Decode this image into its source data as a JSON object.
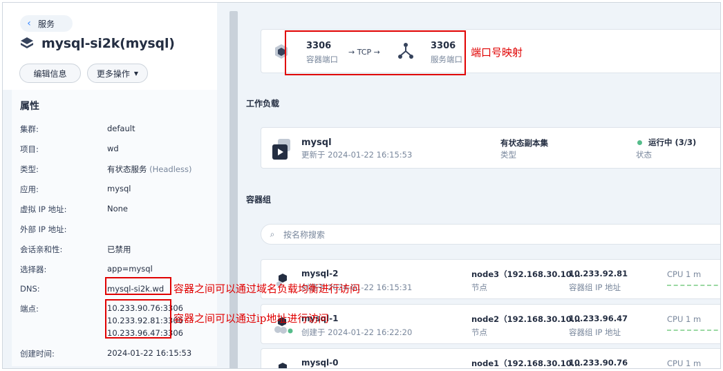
{
  "back_label": "服务",
  "service": {
    "name": "mysql-si2k(mysql)"
  },
  "buttons": {
    "edit": "编辑信息",
    "more": "更多操作"
  },
  "properties": {
    "title": "属性",
    "rows": {
      "cluster": {
        "key": "集群:",
        "value": "default"
      },
      "project": {
        "key": "项目:",
        "value": "wd"
      },
      "type": {
        "key": "类型:",
        "value": "有状态服务",
        "extra": "(Headless)"
      },
      "app": {
        "key": "应用:",
        "value": "mysql"
      },
      "vip": {
        "key": "虚拟 IP 地址:",
        "value": "None"
      },
      "external_ip": {
        "key": "外部 IP 地址:",
        "value": ""
      },
      "session": {
        "key": "会话亲和性:",
        "value": "已禁用"
      },
      "selector": {
        "key": "选择器:",
        "value": "app=mysql"
      },
      "dns": {
        "key": "DNS:",
        "value": "mysql-si2k.wd"
      },
      "endpoints": {
        "key": "端点:",
        "values": [
          "10.233.90.76:3306",
          "10.233.92.81:3306",
          "10.233.96.47:3306"
        ]
      },
      "created": {
        "key": "创建时间:",
        "value": "2024-01-22 16:15:53"
      }
    }
  },
  "annotations": {
    "port_mapping": "端口号映射",
    "dns_note": "容器之间可以通过域名负载均衡进行访问",
    "ip_note": "容器之间可以通过ip地址进行访问"
  },
  "port": {
    "container_port": "3306",
    "container_port_label": "容器端口",
    "protocol": "→ TCP →",
    "service_port": "3306",
    "service_port_label": "服务端口"
  },
  "workload": {
    "section_title": "工作负载",
    "name": "mysql",
    "updated": "更新于 2024-01-22 16:15:53",
    "kind": "有状态副本集",
    "kind_label": "类型",
    "status": "运行中 (3/3)",
    "status_label": "状态",
    "status_color": "#55bc8a"
  },
  "pods": {
    "section_title": "容器组",
    "search_placeholder": "按名称搜索",
    "items": [
      {
        "name": "mysql-2",
        "created": "创建于 2024-01-22 16:15:31",
        "node": "node3（192.168.30.10...",
        "node_label": "节点",
        "ip": "10.233.92.81",
        "ip_label": "容器组 IP 地址",
        "cpu": "CPU 1 m"
      },
      {
        "name": "mysql-1",
        "created": "创建于 2024-01-22 16:22:20",
        "node": "node2（192.168.30.10...",
        "node_label": "节点",
        "ip": "10.233.96.47",
        "ip_label": "容器组 IP 地址",
        "cpu": "CPU 1 m"
      },
      {
        "name": "mysql-0",
        "created": "",
        "node": "node1（192.168.30.10...",
        "node_label": "节点",
        "ip": "10.233.90.76",
        "ip_label": "",
        "cpu": "CPU 1 m"
      }
    ]
  }
}
